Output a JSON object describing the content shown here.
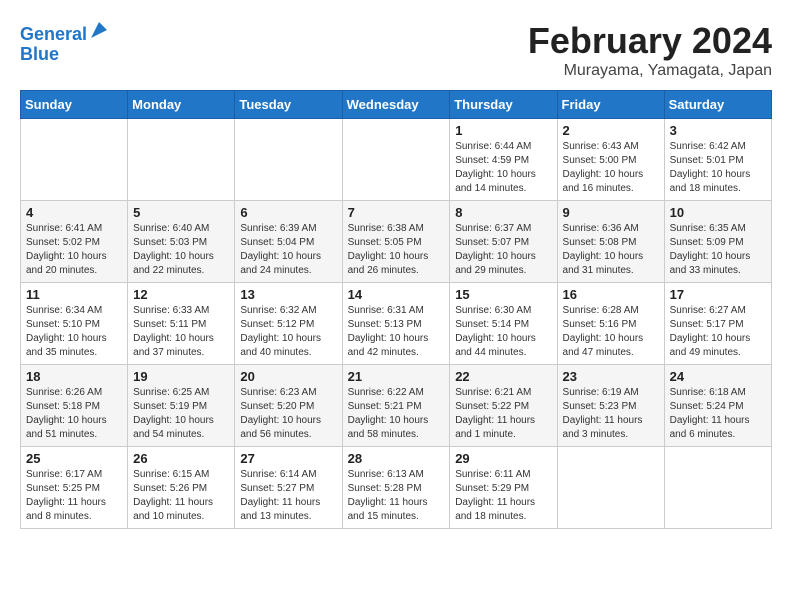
{
  "header": {
    "logo_line1": "General",
    "logo_line2": "Blue",
    "month_title": "February 2024",
    "location": "Murayama, Yamagata, Japan"
  },
  "days_of_week": [
    "Sunday",
    "Monday",
    "Tuesday",
    "Wednesday",
    "Thursday",
    "Friday",
    "Saturday"
  ],
  "weeks": [
    [
      {
        "day": "",
        "info": ""
      },
      {
        "day": "",
        "info": ""
      },
      {
        "day": "",
        "info": ""
      },
      {
        "day": "",
        "info": ""
      },
      {
        "day": "1",
        "info": "Sunrise: 6:44 AM\nSunset: 4:59 PM\nDaylight: 10 hours\nand 14 minutes."
      },
      {
        "day": "2",
        "info": "Sunrise: 6:43 AM\nSunset: 5:00 PM\nDaylight: 10 hours\nand 16 minutes."
      },
      {
        "day": "3",
        "info": "Sunrise: 6:42 AM\nSunset: 5:01 PM\nDaylight: 10 hours\nand 18 minutes."
      }
    ],
    [
      {
        "day": "4",
        "info": "Sunrise: 6:41 AM\nSunset: 5:02 PM\nDaylight: 10 hours\nand 20 minutes."
      },
      {
        "day": "5",
        "info": "Sunrise: 6:40 AM\nSunset: 5:03 PM\nDaylight: 10 hours\nand 22 minutes."
      },
      {
        "day": "6",
        "info": "Sunrise: 6:39 AM\nSunset: 5:04 PM\nDaylight: 10 hours\nand 24 minutes."
      },
      {
        "day": "7",
        "info": "Sunrise: 6:38 AM\nSunset: 5:05 PM\nDaylight: 10 hours\nand 26 minutes."
      },
      {
        "day": "8",
        "info": "Sunrise: 6:37 AM\nSunset: 5:07 PM\nDaylight: 10 hours\nand 29 minutes."
      },
      {
        "day": "9",
        "info": "Sunrise: 6:36 AM\nSunset: 5:08 PM\nDaylight: 10 hours\nand 31 minutes."
      },
      {
        "day": "10",
        "info": "Sunrise: 6:35 AM\nSunset: 5:09 PM\nDaylight: 10 hours\nand 33 minutes."
      }
    ],
    [
      {
        "day": "11",
        "info": "Sunrise: 6:34 AM\nSunset: 5:10 PM\nDaylight: 10 hours\nand 35 minutes."
      },
      {
        "day": "12",
        "info": "Sunrise: 6:33 AM\nSunset: 5:11 PM\nDaylight: 10 hours\nand 37 minutes."
      },
      {
        "day": "13",
        "info": "Sunrise: 6:32 AM\nSunset: 5:12 PM\nDaylight: 10 hours\nand 40 minutes."
      },
      {
        "day": "14",
        "info": "Sunrise: 6:31 AM\nSunset: 5:13 PM\nDaylight: 10 hours\nand 42 minutes."
      },
      {
        "day": "15",
        "info": "Sunrise: 6:30 AM\nSunset: 5:14 PM\nDaylight: 10 hours\nand 44 minutes."
      },
      {
        "day": "16",
        "info": "Sunrise: 6:28 AM\nSunset: 5:16 PM\nDaylight: 10 hours\nand 47 minutes."
      },
      {
        "day": "17",
        "info": "Sunrise: 6:27 AM\nSunset: 5:17 PM\nDaylight: 10 hours\nand 49 minutes."
      }
    ],
    [
      {
        "day": "18",
        "info": "Sunrise: 6:26 AM\nSunset: 5:18 PM\nDaylight: 10 hours\nand 51 minutes."
      },
      {
        "day": "19",
        "info": "Sunrise: 6:25 AM\nSunset: 5:19 PM\nDaylight: 10 hours\nand 54 minutes."
      },
      {
        "day": "20",
        "info": "Sunrise: 6:23 AM\nSunset: 5:20 PM\nDaylight: 10 hours\nand 56 minutes."
      },
      {
        "day": "21",
        "info": "Sunrise: 6:22 AM\nSunset: 5:21 PM\nDaylight: 10 hours\nand 58 minutes."
      },
      {
        "day": "22",
        "info": "Sunrise: 6:21 AM\nSunset: 5:22 PM\nDaylight: 11 hours\nand 1 minute."
      },
      {
        "day": "23",
        "info": "Sunrise: 6:19 AM\nSunset: 5:23 PM\nDaylight: 11 hours\nand 3 minutes."
      },
      {
        "day": "24",
        "info": "Sunrise: 6:18 AM\nSunset: 5:24 PM\nDaylight: 11 hours\nand 6 minutes."
      }
    ],
    [
      {
        "day": "25",
        "info": "Sunrise: 6:17 AM\nSunset: 5:25 PM\nDaylight: 11 hours\nand 8 minutes."
      },
      {
        "day": "26",
        "info": "Sunrise: 6:15 AM\nSunset: 5:26 PM\nDaylight: 11 hours\nand 10 minutes."
      },
      {
        "day": "27",
        "info": "Sunrise: 6:14 AM\nSunset: 5:27 PM\nDaylight: 11 hours\nand 13 minutes."
      },
      {
        "day": "28",
        "info": "Sunrise: 6:13 AM\nSunset: 5:28 PM\nDaylight: 11 hours\nand 15 minutes."
      },
      {
        "day": "29",
        "info": "Sunrise: 6:11 AM\nSunset: 5:29 PM\nDaylight: 11 hours\nand 18 minutes."
      },
      {
        "day": "",
        "info": ""
      },
      {
        "day": "",
        "info": ""
      }
    ]
  ]
}
